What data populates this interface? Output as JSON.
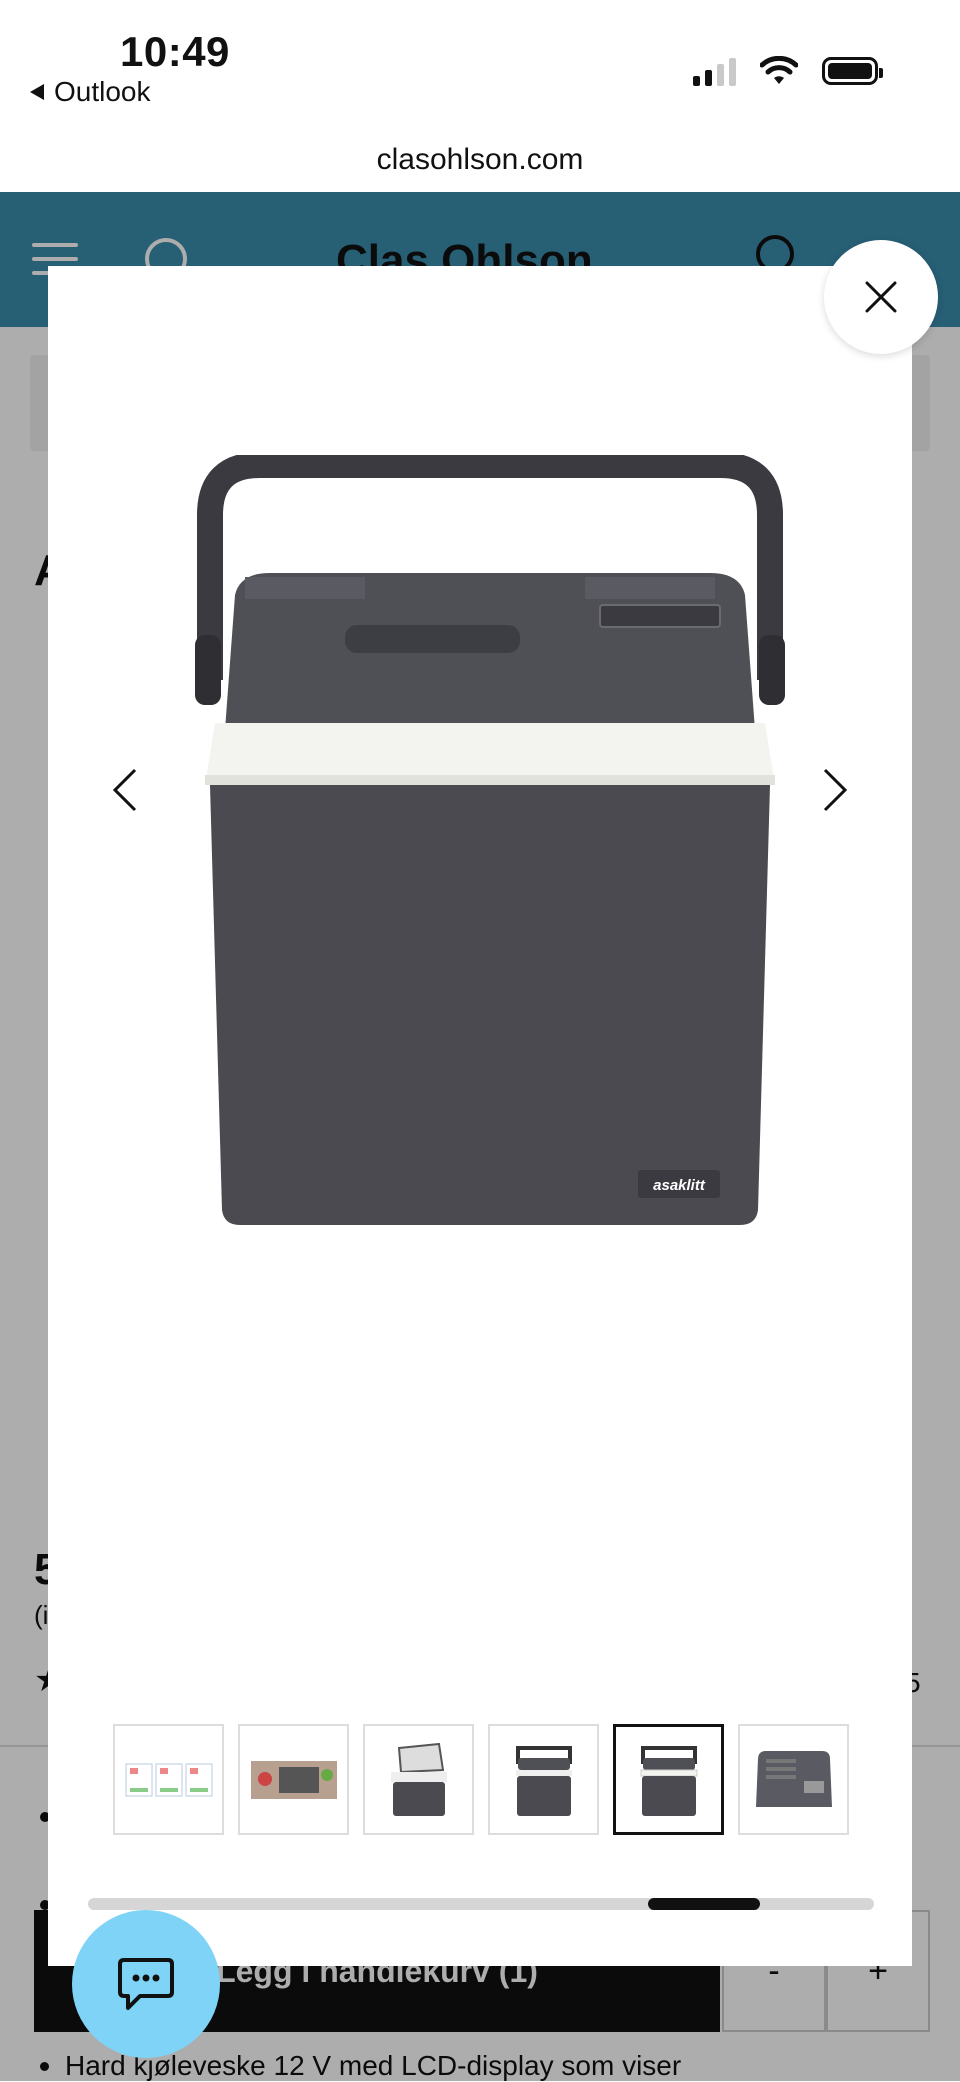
{
  "status_bar": {
    "time": "10:49",
    "back_label": "Outlook"
  },
  "browser": {
    "url": "clasohlson.com"
  },
  "site_header": {
    "logo_text": "Clas Ohlson"
  },
  "background_page": {
    "title_initial": "A",
    "price_fragment": "5",
    "price_sub_fragment": "(i",
    "rating_star": "★",
    "review_count_fragment": "5",
    "add_to_cart_label": "Legg i handlekurv (1)",
    "qty_minus": "-",
    "qty_plus": "+",
    "bullet_text": "Hard kjøleveske 12 V med LCD-display som viser"
  },
  "gallery": {
    "product_brand_badge": "asaklitt",
    "thumbnails": [
      {
        "label": "verified-badges-thumbnail",
        "selected": false
      },
      {
        "label": "cooler-with-food-thumbnail",
        "selected": false
      },
      {
        "label": "cooler-open-lid-thumbnail",
        "selected": false
      },
      {
        "label": "cooler-front-thumbnail",
        "selected": false
      },
      {
        "label": "cooler-front-white-thumbnail",
        "selected": true
      },
      {
        "label": "cooler-lid-panel-thumbnail",
        "selected": false
      }
    ]
  },
  "colors": {
    "header_blue": "#3a8dad",
    "chat_button": "#7ed3f7",
    "cooler_body": "#4a4a50"
  }
}
